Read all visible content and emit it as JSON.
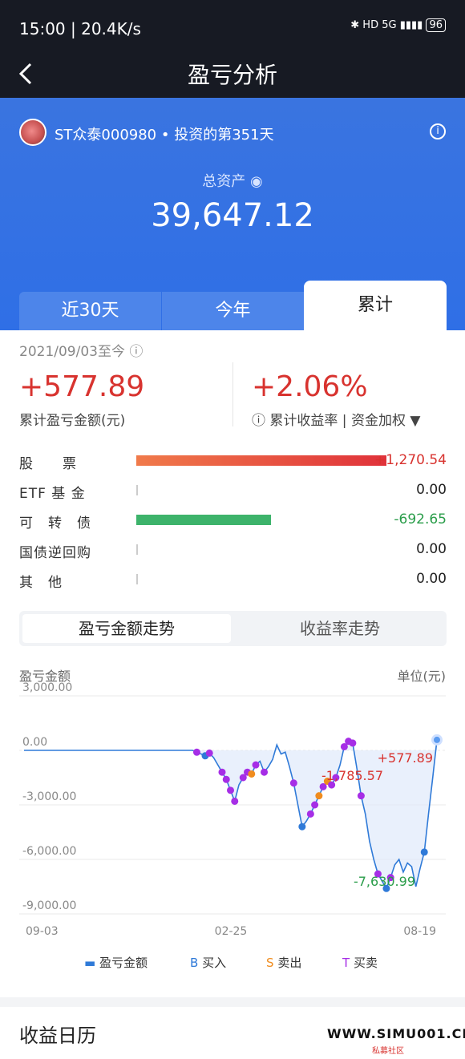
{
  "status": {
    "time": "15:00",
    "speed": "20.4K/s",
    "battery": "96"
  },
  "nav": {
    "title": "盈亏分析"
  },
  "account": {
    "name": "ST众泰000980",
    "days": "投资的第351天",
    "separator": "•"
  },
  "assets": {
    "label": "总资产",
    "value": "39,647.12"
  },
  "tabs": [
    {
      "label": "近30天"
    },
    {
      "label": "今年"
    },
    {
      "label": "累计"
    }
  ],
  "summary": {
    "period": "2021/09/03至今",
    "pnl": "+577.89",
    "pnl_label": "累计盈亏金额(元)",
    "rate": "+2.06%",
    "rate_label": "累计收益率",
    "method": "资金加权"
  },
  "breakdown": [
    {
      "name": "股　　票",
      "value": "+1,270.54",
      "color": "#d8332f",
      "bar_pct": 100
    },
    {
      "name": "ETF 基 金",
      "value": "0.00",
      "color": "#222",
      "bar_pct": 0
    },
    {
      "name": "可　转　债",
      "value": "-692.65",
      "color": "#2a9d4a",
      "bar_pct": 54
    },
    {
      "name": "国债逆回购",
      "value": "0.00",
      "color": "#222",
      "bar_pct": 0
    },
    {
      "name": "其　他",
      "value": "0.00",
      "color": "#222",
      "bar_pct": 0
    }
  ],
  "chart_tabs": [
    {
      "label": "盈亏金额走势"
    },
    {
      "label": "收益率走势"
    }
  ],
  "chart_labels": {
    "title": "盈亏金额",
    "unit": "单位(元)"
  },
  "chart_data": {
    "type": "line",
    "y_ticks": [
      "3,000.00",
      "0.00",
      "-3,000.00",
      "-6,000.00",
      "-9,000.00"
    ],
    "x_ticks": [
      "09-03",
      "02-25",
      "08-19"
    ],
    "ylim": [
      -9000,
      3000
    ],
    "annotations": [
      {
        "text": "+577.89",
        "color": "#d8332f"
      },
      {
        "text": "-1,785.57",
        "color": "#d8332f"
      },
      {
        "text": "-7,630.99",
        "color": "#2a9d4a"
      }
    ],
    "series": [
      {
        "name": "盈亏金额",
        "color": "#2f7ad8",
        "y": [
          0,
          0,
          0,
          0,
          0,
          0,
          0,
          0,
          0,
          0,
          0,
          0,
          0,
          0,
          0,
          0,
          0,
          0,
          0,
          0,
          0,
          0,
          0,
          0,
          0,
          0,
          0,
          0,
          0,
          0,
          0,
          0,
          0,
          0,
          0,
          0,
          0,
          0,
          0,
          0,
          0,
          -100,
          -200,
          -300,
          -150,
          -400,
          -800,
          -1200,
          -1600,
          -2200,
          -2800,
          -1900,
          -1500,
          -1200,
          -1300,
          -800,
          -600,
          -1200,
          -900,
          -500,
          300,
          -200,
          -100,
          -900,
          -1800,
          -3000,
          -4200,
          -3900,
          -3500,
          -3000,
          -2500,
          -2000,
          -1700,
          -1900,
          -1500,
          -800,
          200,
          500,
          400,
          -1000,
          -2500,
          -3500,
          -5000,
          -6000,
          -6800,
          -7200,
          -7600,
          -7000,
          -6300,
          -6000,
          -6700,
          -6200,
          -6400,
          -7500,
          -6500,
          -5600,
          -3500,
          -1500,
          578
        ]
      }
    ],
    "markers": [
      {
        "kind": "T",
        "color": "#a62ee6"
      },
      {
        "kind": "B",
        "color": "#2f7ad8"
      },
      {
        "kind": "S",
        "color": "#f08c1e"
      }
    ]
  },
  "legend": [
    {
      "mark": "—",
      "label": "盈亏金额",
      "color": "#2f7ad8"
    },
    {
      "mark": "B",
      "label": "买入",
      "color": "#2f7ad8"
    },
    {
      "mark": "S",
      "label": "卖出",
      "color": "#f08c1e"
    },
    {
      "mark": "T",
      "label": "买卖",
      "color": "#a62ee6"
    }
  ],
  "calendar": {
    "title": "收益日历"
  },
  "watermark": {
    "text": "WWW.SIMU001.CN",
    "sub": "私募社区"
  }
}
